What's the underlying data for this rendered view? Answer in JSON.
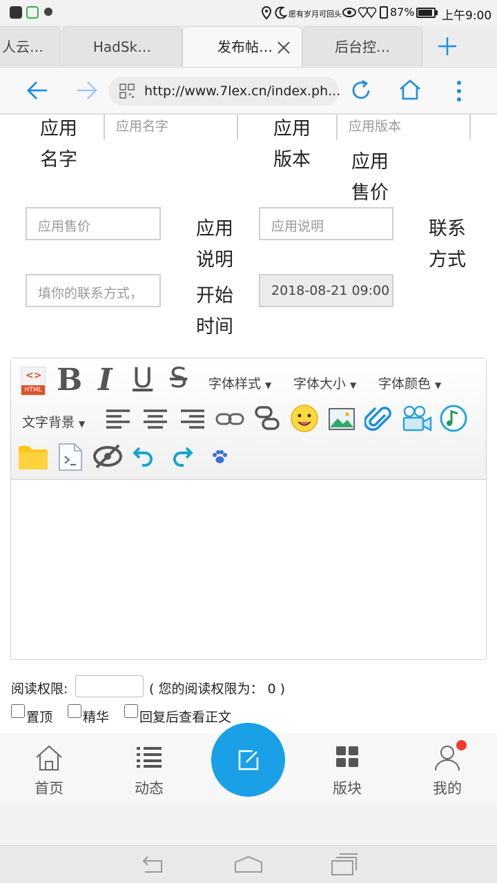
{
  "status_bar": {
    "carrier_text": "愿有岁月可回头",
    "battery": "87%",
    "time": "上午9:00"
  },
  "tabs": [
    {
      "label": "人云…"
    },
    {
      "label": "HadSk…"
    },
    {
      "label": "发布帖…"
    },
    {
      "label": "后台控…"
    }
  ],
  "url_bar": {
    "url": "http://www.7lex.cn/index.ph..."
  },
  "form": {
    "app_name_label": "应用名字",
    "app_name_placeholder": "应用名字",
    "app_version_label": "应用版本",
    "app_version_placeholder": "应用版本",
    "app_price_label": "应用售价",
    "app_price_placeholder": "应用售价",
    "app_desc_label": "应用说明",
    "app_desc_placeholder": "应用说明",
    "contact_label": "联系方式",
    "contact_placeholder": "填你的联系方式，",
    "start_time_label": "开始时间",
    "start_time_value": "2018-08-21 09:00"
  },
  "editor_toolbar": {
    "font_style": "字体样式",
    "font_size": "字体大小",
    "font_color": "字体颜色",
    "text_background": "文字背景",
    "dropdown_arrow": "▼",
    "html_badge": "HTML"
  },
  "post_options": {
    "read_permission_label": "阅读权限:",
    "read_permission_note": "( 您的阅读权限为：  0 )",
    "sticky": "置顶",
    "featured": "精华",
    "reply_to_view": "回复后查看正文"
  },
  "bottom_nav": [
    {
      "label": "首页",
      "icon": "home-icon"
    },
    {
      "label": "动态",
      "icon": "list-icon"
    },
    {
      "label": "版块",
      "icon": "grid-icon"
    },
    {
      "label": "我的",
      "icon": "user-icon"
    }
  ],
  "colors": {
    "accent": "#1aa0e6",
    "notification_dot": "#f03a2e"
  }
}
